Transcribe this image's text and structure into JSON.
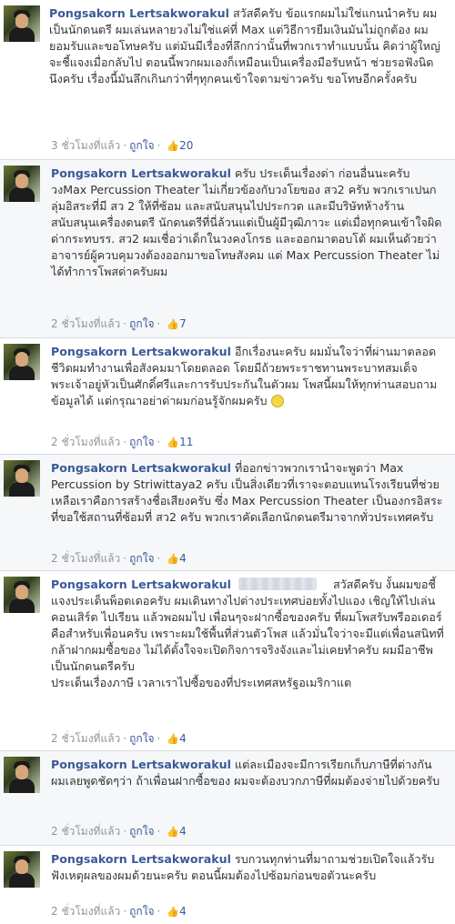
{
  "comments": [
    {
      "name": "Pongsakorn Lertsakworakul",
      "text": "สวัสดีครับ ข้อแรกผมไม่ใช่แกนนำครับ ผมเป็นนักดนตรี ผมเล่นหลายวงไม่ใช่แค่ที่ Max แต่วิธีการยืมเงินมันไม่ถูกต้อง ผมยอมรับและขอโทษครับ แต่มันมีเรื่องที่ลึกกว่านั้นที่พวกเราทำแบบนั้น คิดว่าผู้ใหญ่จะชี้แจงเมื่อกลับไป ตอนนี้พวกผมเองก็เหมือนเป็นเครื่องมือรับหน้า ช่วยรอฟังนิดนึงครับ เรื่องนี้มันลึกเกินกว่าที่ๆทุกคนเข้าใจตามข่าวครับ ขอโทษอีกครั้งครับ",
      "time": "3 ชั่วโมงที่แล้ว",
      "like_label": "ถูกใจ",
      "likes": "20"
    },
    {
      "name": "Pongsakorn Lertsakworakul",
      "text": "ครับ ประเด็นเรื่องด่า ก่อนอื่นนะครับ วงMax Percussion Theater ไม่เกี่ยวข้องกับวงโยของ สว2 ครับ พวกเราเปนกลุ่มอิสระที่มี สว 2 ให้ที่ซ้อม และสนับสนุนไปประกวด และมีบริษัทห้างร้านสนับสนุนเครื่องดนตรี นักดนตรีที่นี่ล้วนแต่เป็นผู้มีวุฒิภาวะ แต่เมื่อทุกคนเข้าใจผิด ด่ากระทบรร. สว2 ผมเชื่อว่าเด็กในวงคงโกรธ และออกมาตอบโต้ ผมเห็นด้วยว่าอาจารย์ผู้ควบคุมวงต้องออกมาขอโทษสังคม แต่ Max Percussion Theater ไม่ได้ทำการโพสด่าครับผม",
      "time": "2 ชั่วโมงที่แล้ว",
      "like_label": "ถูกใจ",
      "likes": "7"
    },
    {
      "name": "Pongsakorn Lertsakworakul",
      "text": "อีกเรื่องนะครับ ผมมั่นใจว่าที่ผ่านมาตลอดชีวิตผมทำงานเพื่อสังคมมาโดยตลอด โดยมีถ้วยพระราชทานพระบาทสมเด็จพระเจ้าอยู่หัวเป็นศักดิ์ศรีและการรับประกันในตัวผม โพสนี้ผมให้ทุกท่านสอบถามข้อมูลได้ แต่กรุณาอย่าด่าผมก่อนรู้จักผมครับ",
      "time": "2 ชั่วโมงที่แล้ว",
      "like_label": "ถูกใจ",
      "likes": "11"
    },
    {
      "name": "Pongsakorn Lertsakworakul",
      "text": "ที่ออกข่าวพวกเรานำจะพูดว่า Max Percussion by Striwittaya2 ครับ เป็นสิ่งเดียวที่เราจะตอบแทนโรงเรียนที่ช่วยเหลือเราคือการสร้างชื่อเสียงครับ ซึ่ง Max Percussion Theater เป็นองกรอิสระที่ขอใช้สถานที่ซ้อมที่ สว2 ครับ พวกเราคัดเลือกนักดนตรีมาจากทั่วประเทศครับ",
      "time": "2 ชั่วโมงที่แล้ว",
      "like_label": "ถูกใจ",
      "likes": "4"
    },
    {
      "name": "Pongsakorn Lertsakworakul",
      "text_a": "สวัสดีครับ",
      "text": "งั้นผมขอชี้แจงประเด็นพ็อตเดอครับ ผมเดินทางไปต่างประเทศบ่อยทั้งไปแอง เชิญให้ไปเล่นคอนเสิร์ต ไปเรียน แล้วพอผมไป เพื่อนๆจะฝากซื้อของครับ ที่ผมโพสรับพรีออเดอร์ คือสำหรับเพื่อนครับ เพราะผมใช้พื้นที่ส่วนตัวโพส แล้วมั่นใจว่าจะมีแต่เพื่อนสนิทที่กล้าฝากผมซื้อของ ไม่ได้ตั้งใจจะเปิดกิจการจริงจังและไม่เคยทำครับ ผมมีอาชีพเป็นนักดนตรีครับ",
      "text_b": "ประเด็นเรื่องภาษี เวลาเราไปซื้อของที่ประเทศสหรัฐอเมริกาแต",
      "time": "2 ชั่วโมงที่แล้ว",
      "like_label": "ถูกใจ",
      "likes": "4"
    },
    {
      "name": "Pongsakorn Lertsakworakul",
      "text": "แต่ละเมืองจะมีการเรียกเก็บภาษีที่ต่างกัน ผมเลยพูดชัดๆว่า ถ้าเพื่อนฝากซื้อของ ผมจะต้องบวกภาษีที่ผมต้องจ่ายไปด้วยครับ",
      "time": "2 ชั่วโมงที่แล้ว",
      "like_label": "ถูกใจ",
      "likes": "4"
    },
    {
      "name": "Pongsakorn Lertsakworakul",
      "text": "รบกวนทุกท่านที่มาถามช่วยเปิดใจแล้วรับฟังเหตุผลของผมด้วยนะครับ ตอนนี้ผมต้องไปซ้อมก่อนขอตัวนะครับ",
      "time": "2 ชั่วโมงที่แล้ว",
      "like_label": "ถูกใจ",
      "likes": "4"
    }
  ]
}
